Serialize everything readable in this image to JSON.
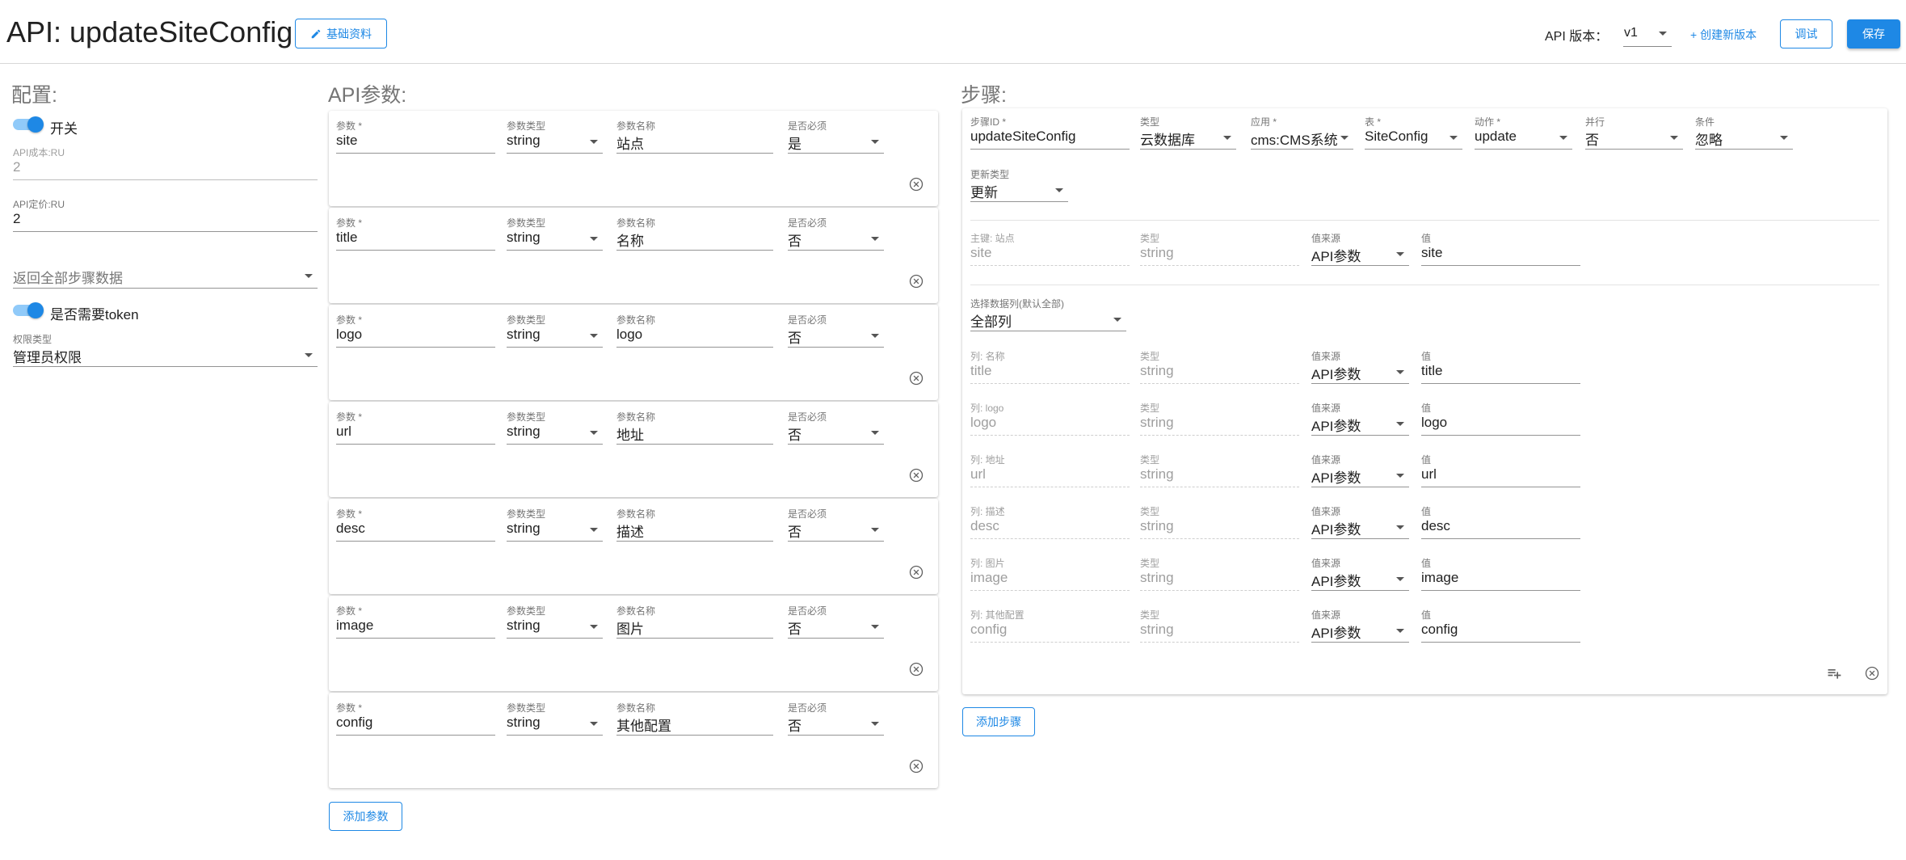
{
  "header": {
    "title": "API: updateSiteConfig",
    "basic_info_button": "基础资料",
    "api_version_label": "API 版本：",
    "api_version_value": "v1",
    "create_version": "+ 创建新版本",
    "debug_button": "调试",
    "save_button": "保存"
  },
  "config": {
    "section_title": "配置:",
    "switch_label": "开关",
    "cost_label": "API成本:RU",
    "cost_value": "2",
    "price_label": "API定价:RU",
    "price_value": "2",
    "return_all_placeholder": "返回全部步骤数据",
    "token_label": "是否需要token",
    "permission_label": "权限类型",
    "permission_value": "管理员权限"
  },
  "params": {
    "section_title": "API参数:",
    "col_param": "参数 *",
    "col_type": "参数类型",
    "col_name": "参数名称",
    "col_required": "是否必须",
    "items": [
      {
        "param": "site",
        "type": "string",
        "name": "站点",
        "required": "是"
      },
      {
        "param": "title",
        "type": "string",
        "name": "名称",
        "required": "否"
      },
      {
        "param": "logo",
        "type": "string",
        "name": "logo",
        "required": "否"
      },
      {
        "param": "url",
        "type": "string",
        "name": "地址",
        "required": "否"
      },
      {
        "param": "desc",
        "type": "string",
        "name": "描述",
        "required": "否"
      },
      {
        "param": "image",
        "type": "string",
        "name": "图片",
        "required": "否"
      },
      {
        "param": "config",
        "type": "string",
        "name": "其他配置",
        "required": "否"
      }
    ],
    "add_button": "添加参数"
  },
  "steps": {
    "section_title": "步骤:",
    "step_id_label": "步骤ID *",
    "step_id_value": "updateSiteConfig",
    "type_label": "类型",
    "type_value": "云数据库",
    "app_label": "应用 *",
    "app_value": "cms:CMS系统",
    "table_label": "表 *",
    "table_value": "SiteConfig",
    "action_label": "动作 *",
    "action_value": "update",
    "parallel_label": "并行",
    "parallel_value": "否",
    "condition_label": "条件",
    "condition_value": "忽略",
    "update_type_label": "更新类型",
    "update_type_value": "更新",
    "key_label": "主键: 站点",
    "key_value": "site",
    "key_type_label": "类型",
    "key_type_value": "string",
    "key_source_label": "值来源",
    "key_source_value": "API参数",
    "key_val_label": "值",
    "key_val_value": "site",
    "select_cols_label": "选择数据列(默认全部)",
    "select_cols_value": "全部列",
    "columns": [
      {
        "label": "列: 名称",
        "name": "title",
        "type_label": "类型",
        "type": "string",
        "source_label": "值来源",
        "source": "API参数",
        "value_label": "值",
        "value": "title"
      },
      {
        "label": "列: logo",
        "name": "logo",
        "type_label": "类型",
        "type": "string",
        "source_label": "值来源",
        "source": "API参数",
        "value_label": "值",
        "value": "logo"
      },
      {
        "label": "列: 地址",
        "name": "url",
        "type_label": "类型",
        "type": "string",
        "source_label": "值来源",
        "source": "API参数",
        "value_label": "值",
        "value": "url"
      },
      {
        "label": "列: 描述",
        "name": "desc",
        "type_label": "类型",
        "type": "string",
        "source_label": "值来源",
        "source": "API参数",
        "value_label": "值",
        "value": "desc"
      },
      {
        "label": "列: 图片",
        "name": "image",
        "type_label": "类型",
        "type": "string",
        "source_label": "值来源",
        "source": "API参数",
        "value_label": "值",
        "value": "image"
      },
      {
        "label": "列: 其他配置",
        "name": "config",
        "type_label": "类型",
        "type": "string",
        "source_label": "值来源",
        "source": "API参数",
        "value_label": "值",
        "value": "config"
      }
    ],
    "add_button": "添加步骤"
  },
  "icons": {
    "edit": "pencil-icon",
    "close": "close-circle-icon",
    "add_row": "playlist-add-icon",
    "dropdown": "chevron-down-icon"
  },
  "colors": {
    "primary": "#1e88e5",
    "toggle_track": "#90caf9"
  }
}
